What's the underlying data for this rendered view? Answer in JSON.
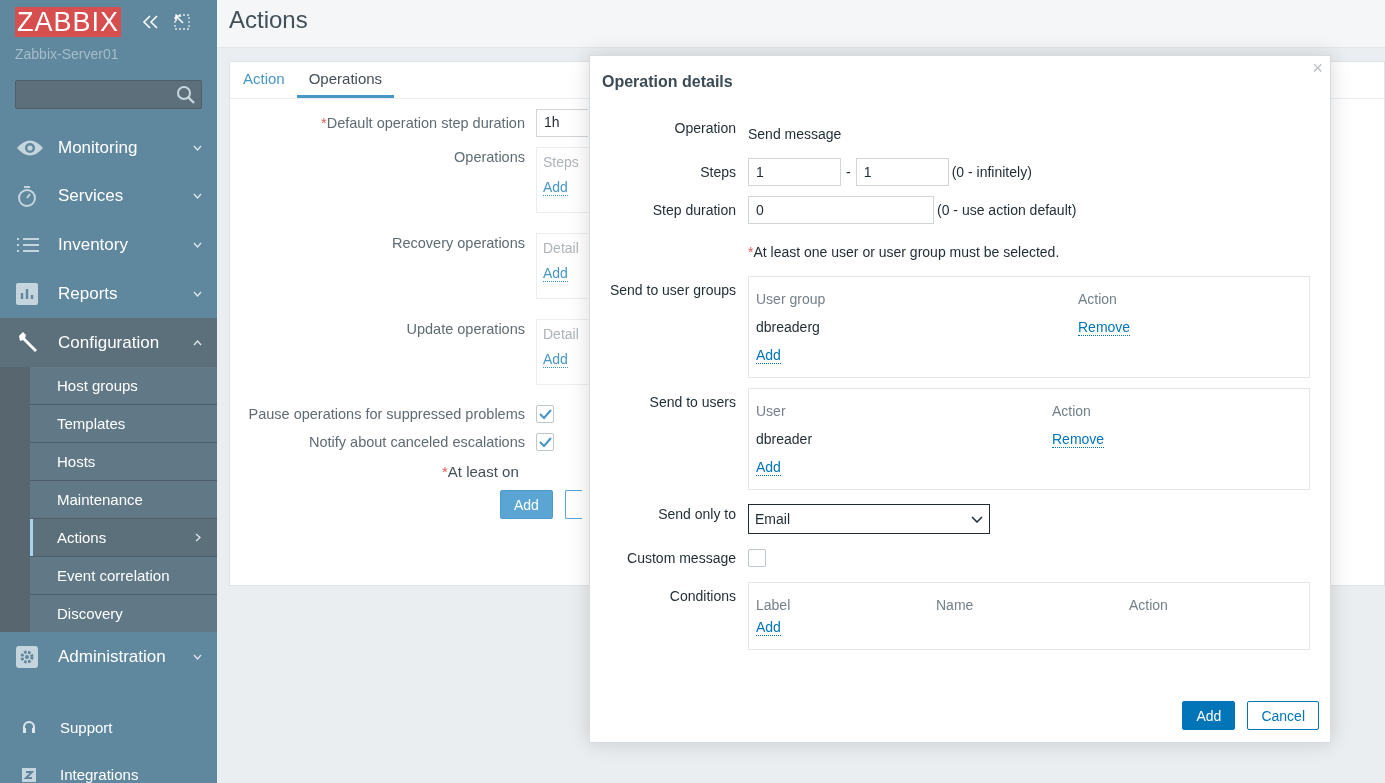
{
  "sidebar": {
    "logo": "ZABBIX",
    "server": "Zabbix-Server01",
    "menu": [
      {
        "label": "Monitoring",
        "expanded": false
      },
      {
        "label": "Services",
        "expanded": false
      },
      {
        "label": "Inventory",
        "expanded": false
      },
      {
        "label": "Reports",
        "expanded": false
      },
      {
        "label": "Configuration",
        "expanded": true,
        "children": [
          {
            "label": "Host groups",
            "selected": false
          },
          {
            "label": "Templates",
            "selected": false
          },
          {
            "label": "Hosts",
            "selected": false
          },
          {
            "label": "Maintenance",
            "selected": false
          },
          {
            "label": "Actions",
            "selected": true
          },
          {
            "label": "Event correlation",
            "selected": false
          },
          {
            "label": "Discovery",
            "selected": false
          }
        ]
      },
      {
        "label": "Administration",
        "expanded": false
      }
    ],
    "footer_links": [
      "Support",
      "Integrations"
    ]
  },
  "page_title": "Actions",
  "tabs": [
    {
      "label": "Action",
      "selected": false
    },
    {
      "label": "Operations",
      "selected": true
    }
  ],
  "form": {
    "step_duration": {
      "required_mark": "*",
      "label": "Default operation step duration",
      "value": "1h"
    },
    "sections": [
      {
        "label": "Operations",
        "column": "Steps",
        "link": "Add"
      },
      {
        "label": "Recovery operations",
        "column": "Detail",
        "link": "Add"
      },
      {
        "label": "Update operations",
        "column": "Detail",
        "link": "Add"
      }
    ],
    "checkboxes": [
      {
        "label": "Pause operations for suppressed problems",
        "checked": true
      },
      {
        "label": "Notify about canceled escalations",
        "checked": true
      }
    ],
    "note_mark": "*",
    "note": "At least on",
    "submit": "Add"
  },
  "dialog": {
    "title": "Operation details",
    "close": "×",
    "operation": {
      "label": "Operation",
      "value": "Send message"
    },
    "steps": {
      "label": "Steps",
      "from": "1",
      "separator": "-",
      "to": "1",
      "hint": "(0 - infinitely)"
    },
    "step_duration": {
      "label": "Step duration",
      "value": "0",
      "hint": "(0 - use action default)"
    },
    "note_mark": "*",
    "note": "At least one user or user group must be selected.",
    "lists": [
      {
        "label": "Send to user groups",
        "columns": [
          {
            "label": "User group",
            "kind": "text"
          },
          {
            "label": "Action",
            "kind": "link"
          }
        ],
        "rows": [
          [
            "dbreaderg",
            "Remove"
          ]
        ],
        "add": "Add"
      },
      {
        "label": "Send to users",
        "columns": [
          {
            "label": "User",
            "kind": "text"
          },
          {
            "label": "Action",
            "kind": "link"
          }
        ],
        "rows": [
          [
            "dbreader",
            "Remove"
          ]
        ],
        "add": "Add"
      }
    ],
    "send_only_to": {
      "label": "Send only to",
      "value": "Email"
    },
    "custom_message": {
      "label": "Custom message",
      "checked": false
    },
    "conditions": {
      "label": "Conditions",
      "columns": [
        {
          "label": "Label"
        },
        {
          "label": "Name"
        },
        {
          "label": "Action"
        }
      ],
      "add": "Add"
    },
    "buttons": [
      {
        "label": "Add",
        "kind": "primary"
      },
      {
        "label": "Cancel",
        "kind": "secondary"
      }
    ]
  }
}
